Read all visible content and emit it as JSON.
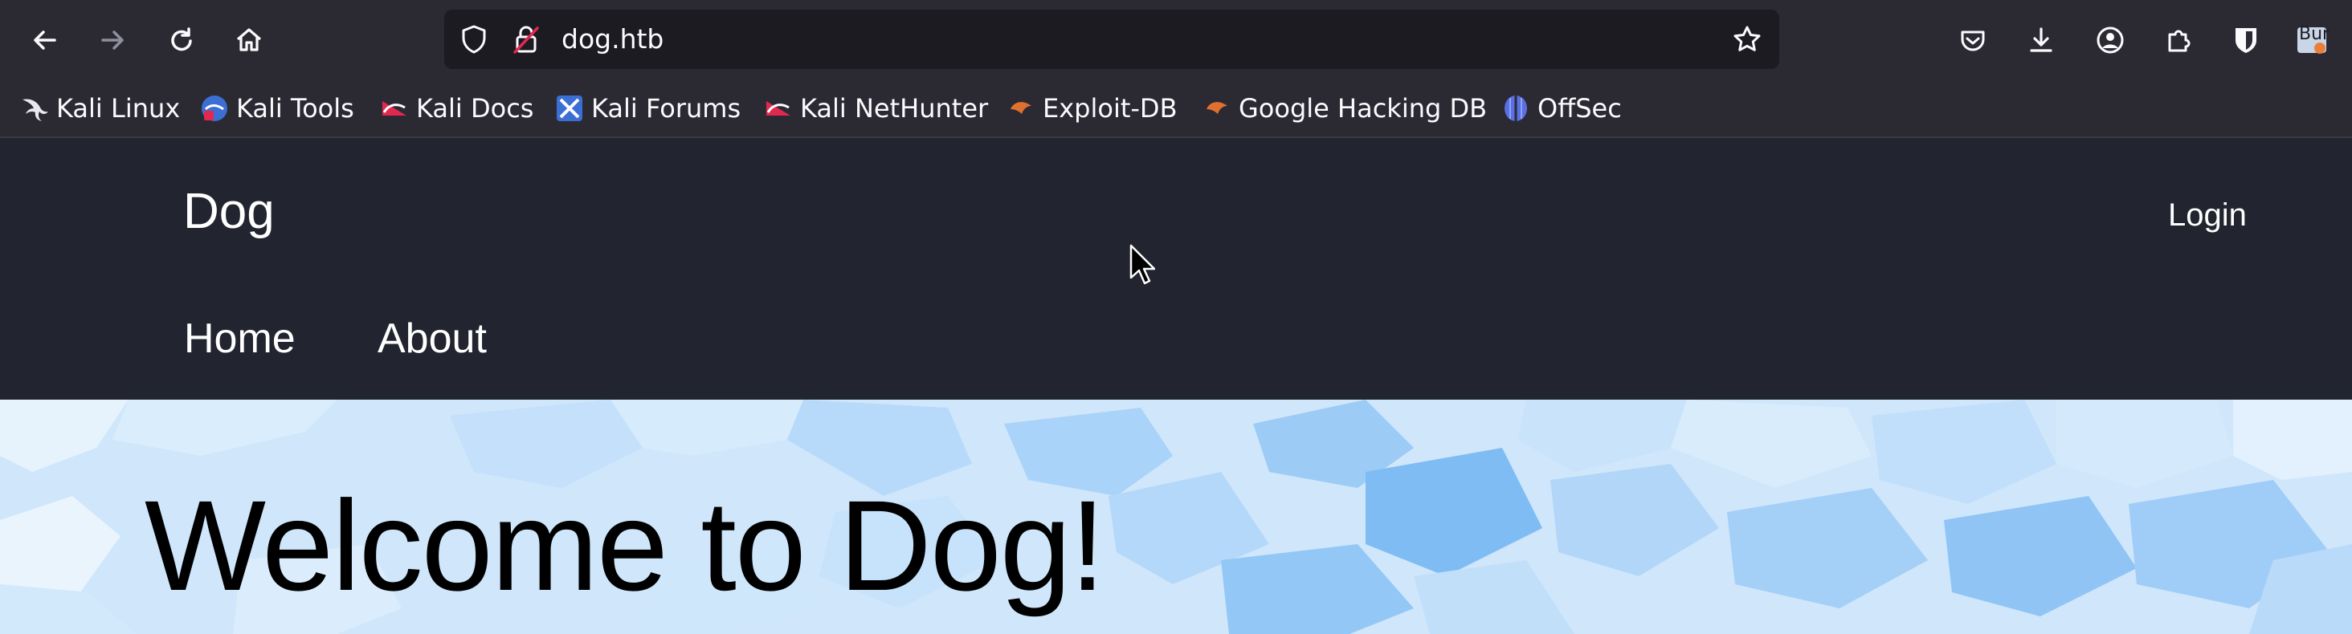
{
  "browser": {
    "url": "dog.htb",
    "extension_badge": "Bur"
  },
  "bookmarks": [
    {
      "label": "Kali Linux",
      "icon": "kali-dragon-icon"
    },
    {
      "label": "Kali Tools",
      "icon": "kali-tools-icon"
    },
    {
      "label": "Kali Docs",
      "icon": "kali-docs-icon"
    },
    {
      "label": "Kali Forums",
      "icon": "kali-forums-icon"
    },
    {
      "label": "Kali NetHunter",
      "icon": "kali-nethunter-icon"
    },
    {
      "label": "Exploit-DB",
      "icon": "exploit-db-icon"
    },
    {
      "label": "Google Hacking DB",
      "icon": "ghdb-icon"
    },
    {
      "label": "OffSec",
      "icon": "offsec-icon"
    }
  ],
  "site": {
    "name": "Dog",
    "login": "Login",
    "nav": [
      "Home",
      "About"
    ],
    "hero_title": "Welcome to Dog!"
  },
  "colors": {
    "toolbar_bg": "#2b2a33",
    "urlbar_bg": "#1c1b22",
    "header_bg": "#22252f",
    "hero_bg": "#cde6fb"
  }
}
